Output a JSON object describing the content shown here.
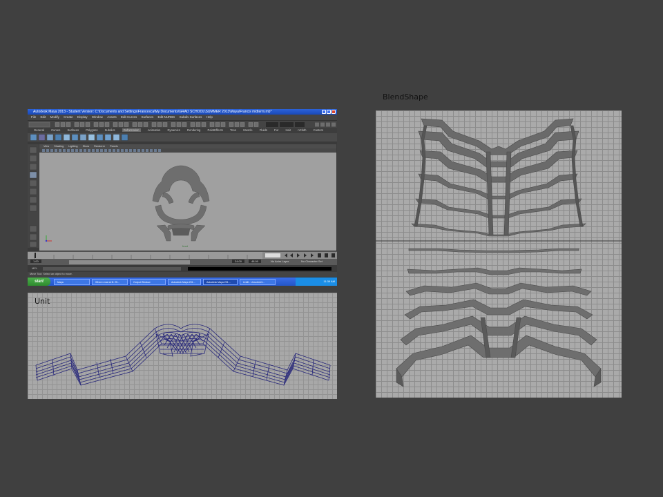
{
  "blend_label": "BlendShape",
  "unit_label": "Unit",
  "maya": {
    "title": "Autodesk Maya 2013 - Student Version: C:\\Documents and Settings\\Francesca\\My Documents\\GRAD SCHOOL\\SUMMER 2013\\Maya\\Francis midterm.mb*",
    "menus": [
      "File",
      "Edit",
      "Modify",
      "Create",
      "Display",
      "Window",
      "Assets",
      "Edit Curves",
      "Surfaces",
      "Edit NURBS",
      "Subdiv Surfaces",
      "Help"
    ],
    "shelf_tabs": [
      "General",
      "Curves",
      "Surfaces",
      "Polygons",
      "Subdivs",
      "Deformation",
      "Animation",
      "Dynamics",
      "Rendering",
      "PaintEffects",
      "Toon",
      "Muscle",
      "Fluids",
      "Fur",
      "Hair",
      "nCloth",
      "Custom"
    ],
    "panel_menus": [
      "View",
      "Shading",
      "Lighting",
      "Show",
      "Renderer",
      "Panels"
    ],
    "viewport_label": "front",
    "help_text": "Move Tool: Select an object to move.",
    "cmd_label": "MEL",
    "time_start": "1.00",
    "time_end": "24.00",
    "range_end": "48.00",
    "anim_layer": "No Anim Layer",
    "char_set": "No Character Set"
  },
  "taskbar": {
    "start_label": "start",
    "tasks": [
      "Maya",
      "Where=mat at B: 25...",
      "Output Window",
      "Autodesk Maya 201...",
      "Autodesk Maya 201...",
      "Untitl - Unsolved1..."
    ],
    "clock": "11:39 AM"
  }
}
